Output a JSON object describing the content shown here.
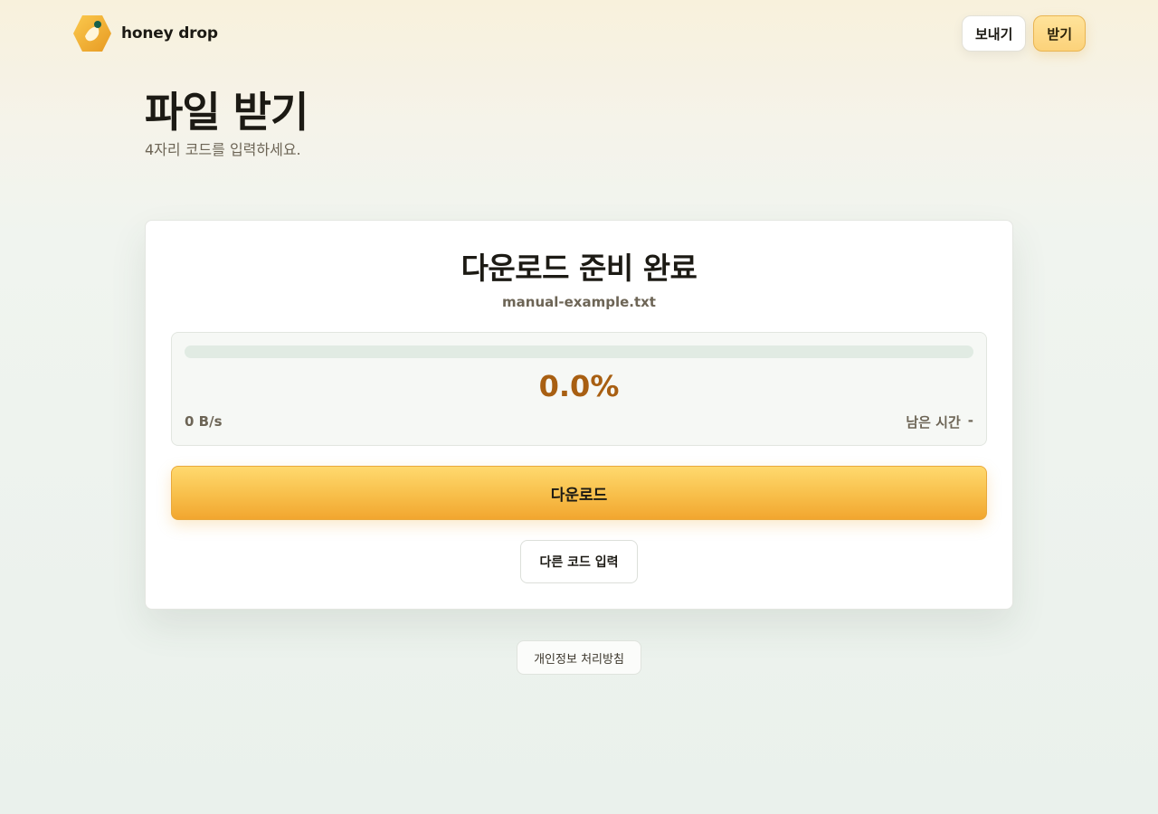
{
  "header": {
    "brand_name": "honey drop",
    "nav_send": "보내기",
    "nav_receive": "받기"
  },
  "page": {
    "title": "파일 받기",
    "subtitle": "4자리 코드를 입력하세요."
  },
  "card": {
    "title": "다운로드 준비 완료",
    "file_name": "manual-example.txt",
    "progress_fraction": 0,
    "progress_text": "0.0%",
    "speed": "0 B/s",
    "eta_label": "남은 시간",
    "eta_value": "-",
    "download_label": "다운로드",
    "other_code_label": "다른 코드 입력"
  },
  "footer": {
    "privacy_label": "개인정보 처리방침"
  },
  "colors": {
    "accent": "#f2a62f",
    "progress_text": "#a85f12",
    "logo_dot": "#16604a"
  },
  "icons": {
    "logo": "honey-drop-hexagon-logo-icon"
  }
}
